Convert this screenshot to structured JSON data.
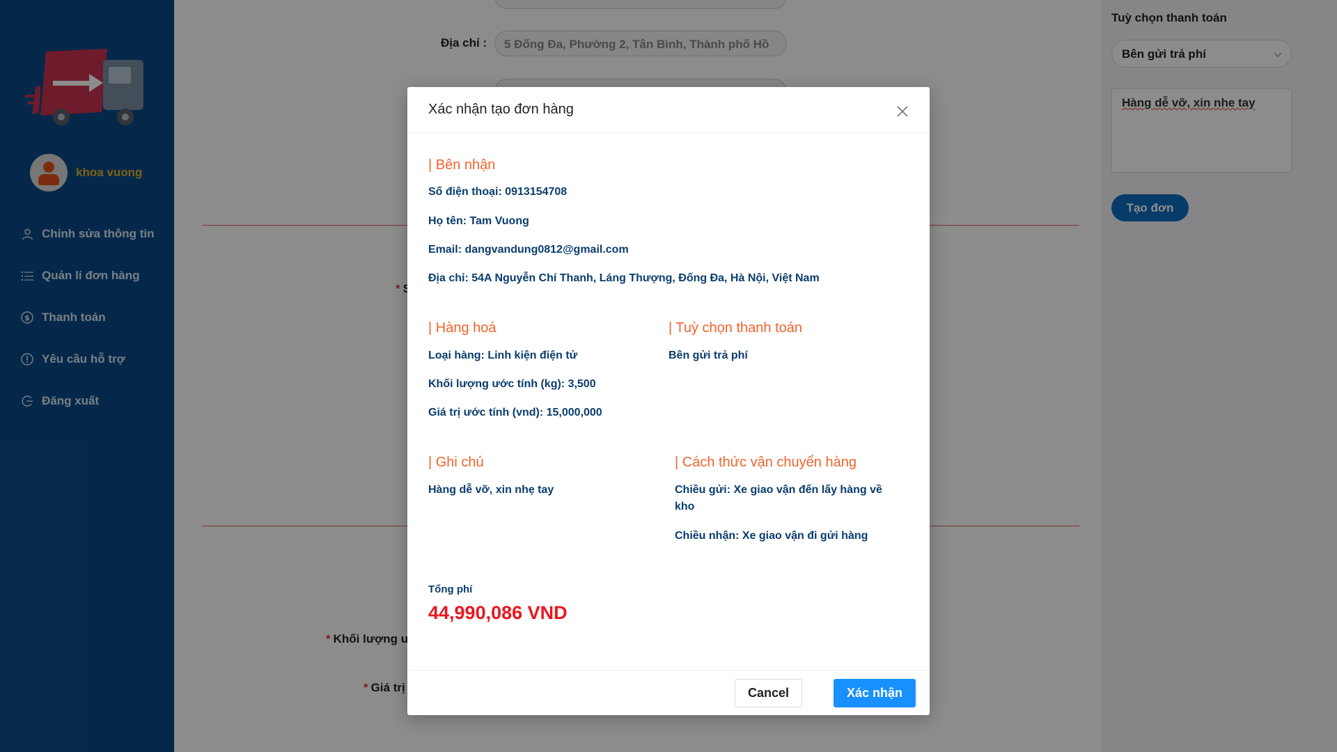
{
  "sidebar": {
    "username": "khoa vuong",
    "menu": [
      {
        "label": "Chỉnh sửa thông tin",
        "icon": "user-icon"
      },
      {
        "label": "Quản lí đơn hàng",
        "icon": "list-icon"
      },
      {
        "label": "Thanh toán",
        "icon": "dollar-icon"
      },
      {
        "label": "Yêu cầu hỗ trợ",
        "icon": "alert-icon"
      },
      {
        "label": "Đăng xuất",
        "icon": "logout-icon"
      }
    ]
  },
  "form": {
    "address_label": "Địa chỉ :",
    "address_value": "5 Đống Đa, Phường 2, Tân Bình, Thành phố Hồ",
    "weight_label": "Khối lượng ư",
    "value_label": "Giá trị",
    "partial_label": "S"
  },
  "right_panel": {
    "title": "Tuỳ chọn thanh toán",
    "payment_option": "Bên gửi trả phí",
    "note": "Hàng dễ vỡ, xin nhe tay",
    "create_button": "Tạo đơn"
  },
  "modal": {
    "title": "Xác nhận tạo đơn hàng",
    "receiver": {
      "heading": "| Bên nhận",
      "phone": "Số điện thoại: 0913154708",
      "name": "Họ tên: Tam Vuong",
      "email": "Email: dangvandung0812@gmail.com",
      "address": "Địa chỉ: 54A Nguyễn Chí Thanh, Láng Thượng, Đống Đa, Hà Nội, Việt Nam"
    },
    "goods": {
      "heading": "| Hàng hoá",
      "type": "Loại hàng: Linh kiện điện tử",
      "weight": "Khối lượng ước tính (kg): 3,500",
      "value": "Giá trị ước tính (vnd): 15,000,000"
    },
    "payment": {
      "heading": "| Tuỳ chọn thanh toán",
      "option": "Bên gửi trả phí"
    },
    "note": {
      "heading": "| Ghi chú",
      "text": "Hàng dễ vỡ, xin nhẹ tay"
    },
    "shipping": {
      "heading": "| Cách thức vận chuyển hàng",
      "send": "Chiều gửi: Xe giao vận đến lấy hàng về kho",
      "receive": "Chiều nhận: Xe giao vận đi gửi hàng"
    },
    "total_label": "Tổng phí",
    "total_value": "44,990,086 VND",
    "cancel_label": "Cancel",
    "confirm_label": "Xác nhận"
  },
  "colors": {
    "sidebar_bg": "#0a4a87",
    "accent_orange": "#f0642d",
    "total_red": "#e8171f",
    "primary_blue": "#1890ff",
    "username_gold": "#e8b223"
  }
}
